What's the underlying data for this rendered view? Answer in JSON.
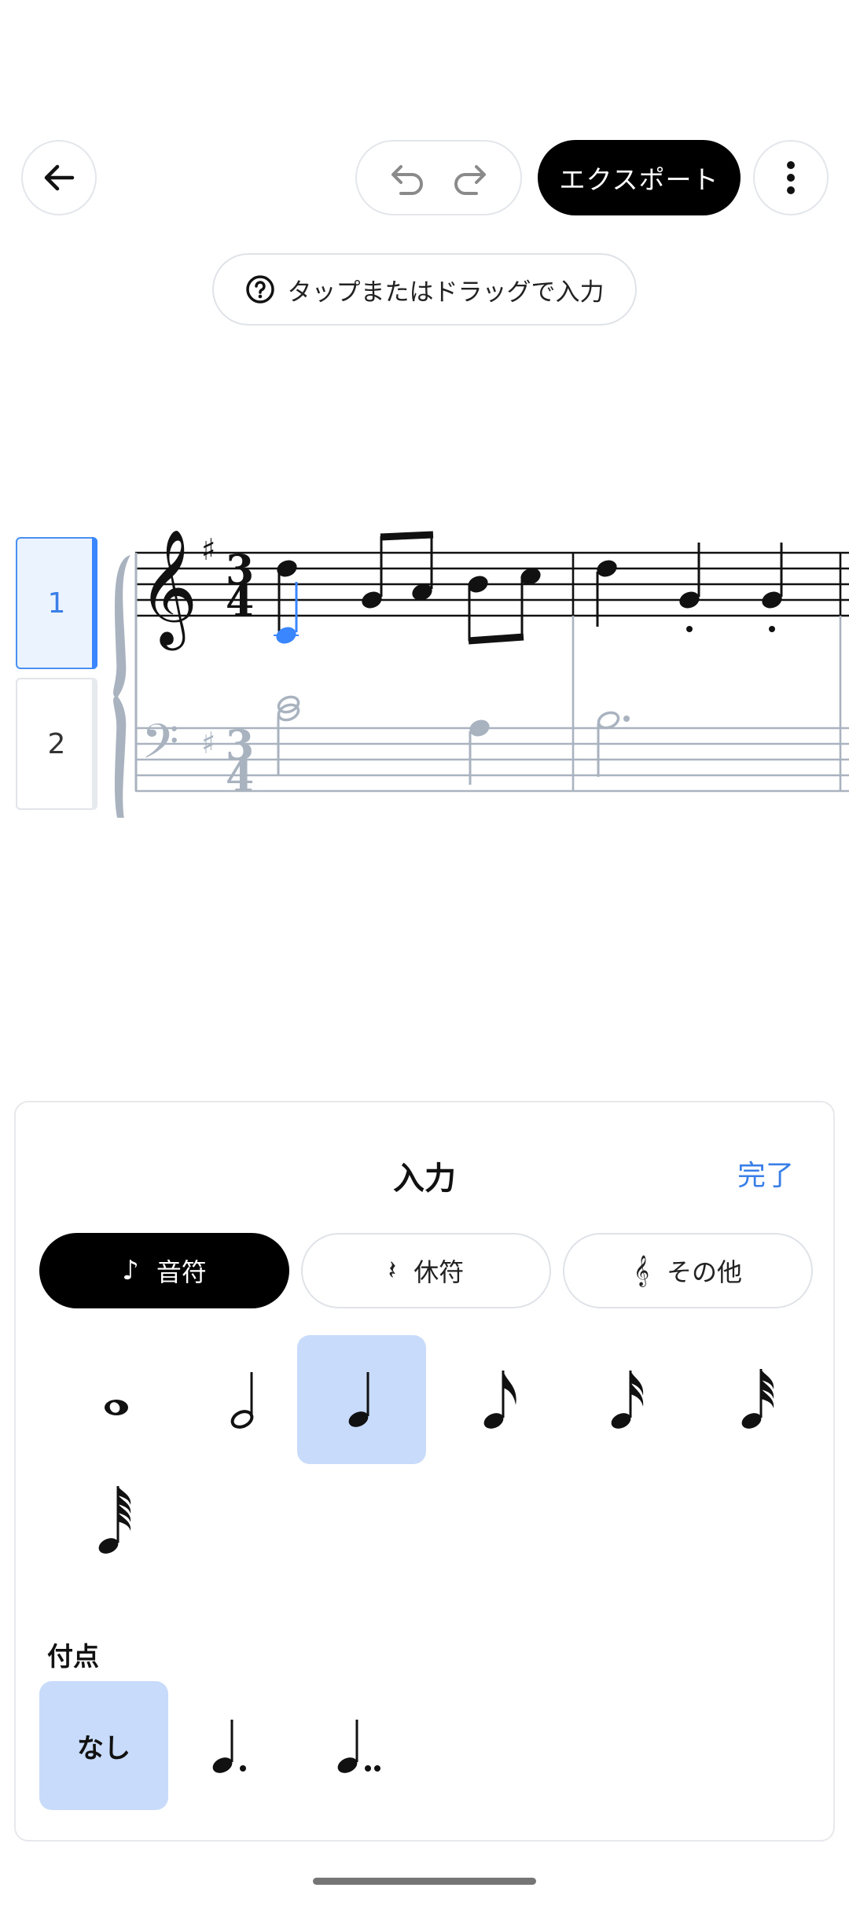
{
  "header": {
    "export_label": "エクスポート"
  },
  "hint": {
    "label": "タップまたはドラッグで入力"
  },
  "parts": [
    {
      "label": "1"
    },
    {
      "label": "2"
    }
  ],
  "score": {
    "treble_clef": "𝄞",
    "bass_clef": "𝄢",
    "time_signature": {
      "top": "3",
      "bottom": "4"
    },
    "key_sharp": "♯"
  },
  "panel": {
    "title": "入力",
    "done_label": "完了",
    "segments": [
      {
        "label": "音符",
        "icon": "♪"
      },
      {
        "label": "休符",
        "icon": "𝄽"
      },
      {
        "label": "その他",
        "icon": "𝄞"
      }
    ],
    "durations": [
      "whole",
      "half",
      "quarter",
      "eighth",
      "sixteenth",
      "thirty-second",
      "sixty-fourth"
    ],
    "selected_duration": "quarter",
    "dot_section_label": "付点",
    "dot_options": {
      "none_label": "なし"
    },
    "selected_dot": "none"
  },
  "colors": {
    "accent": "#3a7ee8",
    "selection": "#c9dbfa",
    "inactive_staff": "#a9b3c0"
  }
}
